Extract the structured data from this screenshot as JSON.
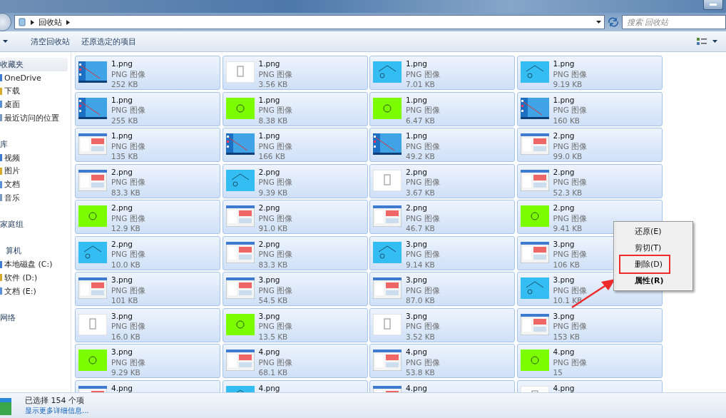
{
  "address_bar": {
    "path": [
      "回收站"
    ]
  },
  "search": {
    "placeholder": "搜索 回收站"
  },
  "toolbar": {
    "buttons": [
      "清空回收站",
      "还原选定的项目"
    ]
  },
  "sidebar": {
    "groups": [
      {
        "label": "收藏夹",
        "selected": true,
        "children": [
          {
            "label": "OneDrive"
          },
          {
            "label": "下载"
          },
          {
            "label": "桌面"
          },
          {
            "label": "最近访问的位置"
          }
        ]
      },
      {
        "label": "库",
        "selected": false,
        "children": [
          {
            "label": "视频"
          },
          {
            "label": "图片"
          },
          {
            "label": "文档"
          },
          {
            "label": "音乐"
          }
        ]
      },
      {
        "label": "家庭组",
        "selected": false
      },
      {
        "label": "算机",
        "selected": false,
        "children": [
          {
            "label": "本地磁盘 (C:)"
          },
          {
            "label": "软件 (D:)"
          },
          {
            "label": "文档 (E:)"
          }
        ]
      },
      {
        "label": "网络",
        "selected": false
      }
    ]
  },
  "files": [
    {
      "name": "1.png",
      "type": "PNG 图像",
      "size": "252 KB",
      "selected": true
    },
    {
      "name": "1.png",
      "type": "PNG 图像",
      "size": "3.56 KB",
      "selected": true
    },
    {
      "name": "1.png",
      "type": "PNG 图像",
      "size": "7.01 KB",
      "selected": true
    },
    {
      "name": "1.png",
      "type": "PNG 图像",
      "size": "9.19 KB",
      "selected": true
    },
    {
      "name": "1.png",
      "type": "PNG 图像",
      "size": "255 KB",
      "selected": true
    },
    {
      "name": "1.png",
      "type": "PNG 图像",
      "size": "8.38 KB",
      "selected": true
    },
    {
      "name": "1.png",
      "type": "PNG 图像",
      "size": "6.47 KB",
      "selected": true
    },
    {
      "name": "1.png",
      "type": "PNG 图像",
      "size": "160 KB",
      "selected": true
    },
    {
      "name": "1.png",
      "type": "PNG 图像",
      "size": "135 KB",
      "selected": true
    },
    {
      "name": "1.png",
      "type": "PNG 图像",
      "size": "166 KB",
      "selected": true
    },
    {
      "name": "1.png",
      "type": "PNG 图像",
      "size": "49.2 KB",
      "selected": true
    },
    {
      "name": "2.png",
      "type": "PNG 图像",
      "size": "99.0 KB",
      "selected": true
    },
    {
      "name": "2.png",
      "type": "PNG 图像",
      "size": "83.3 KB",
      "selected": true
    },
    {
      "name": "2.png",
      "type": "PNG 图像",
      "size": "9.39 KB",
      "selected": true
    },
    {
      "name": "2.png",
      "type": "PNG 图像",
      "size": "3.67 KB",
      "selected": true
    },
    {
      "name": "2.png",
      "type": "PNG 图像",
      "size": "52.3 KB",
      "selected": true
    },
    {
      "name": "2.png",
      "type": "PNG 图像",
      "size": "12.9 KB",
      "selected": true
    },
    {
      "name": "2.png",
      "type": "PNG 图像",
      "size": "91.0 KB",
      "selected": true
    },
    {
      "name": "2.png",
      "type": "PNG 图像",
      "size": "46.7 KB",
      "selected": true
    },
    {
      "name": "2.png",
      "type": "PNG 图像",
      "size": "9.41 KB",
      "selected": true
    },
    {
      "name": "2.png",
      "type": "PNG 图像",
      "size": "10.0 KB",
      "selected": true
    },
    {
      "name": "2.png",
      "type": "PNG 图像",
      "size": "83.3 KB",
      "selected": true
    },
    {
      "name": "3.png",
      "type": "PNG 图像",
      "size": "9.14 KB",
      "selected": true
    },
    {
      "name": "3.png",
      "type": "PNG 图像",
      "size": "106 KB",
      "selected": true
    },
    {
      "name": "3.png",
      "type": "PNG 图像",
      "size": "101 KB",
      "selected": true
    },
    {
      "name": "3.png",
      "type": "PNG 图像",
      "size": "54.5 KB",
      "selected": true
    },
    {
      "name": "3.png",
      "type": "PNG 图像",
      "size": "87.0 KB",
      "selected": true
    },
    {
      "name": "3.png",
      "type": "PNG 图像",
      "size": "10.1 KB",
      "selected": true
    },
    {
      "name": "3.png",
      "type": "PNG 图像",
      "size": "16.0 KB",
      "selected": true
    },
    {
      "name": "3.png",
      "type": "PNG 图像",
      "size": "13.5 KB",
      "selected": true
    },
    {
      "name": "3.png",
      "type": "PNG 图像",
      "size": "3.52 KB",
      "selected": true
    },
    {
      "name": "3.png",
      "type": "PNG 图像",
      "size": "153 KB",
      "selected": true
    },
    {
      "name": "3.png",
      "type": "PNG 图像",
      "size": "9.29 KB",
      "selected": true
    },
    {
      "name": "4.png",
      "type": "PNG 图像",
      "size": "68.1 KB",
      "selected": true
    },
    {
      "name": "4.png",
      "type": "PNG 图像",
      "size": "53.8 KB",
      "selected": true
    },
    {
      "name": "4.png",
      "type": "PNG 图像",
      "size": "15",
      "selected": true
    },
    {
      "name": "4.png",
      "selected": true
    },
    {
      "name": "4.png",
      "selected": true
    },
    {
      "name": "4.png",
      "selected": true
    },
    {
      "name": "4.png",
      "selected": true
    }
  ],
  "context_menu": {
    "items": [
      {
        "label": "还原(E)",
        "bold": false,
        "highlighted": false
      },
      {
        "label": "剪切(T)",
        "bold": false,
        "highlighted": false
      },
      {
        "label": "删除(D)",
        "bold": false,
        "highlighted": true
      },
      {
        "label": "属性(R)",
        "bold": true,
        "highlighted": false
      }
    ]
  },
  "annotations": {
    "arrow": true
  },
  "status_bar": {
    "selection": "已选择 154 个项",
    "details_link": "显示更多详细信息..."
  }
}
